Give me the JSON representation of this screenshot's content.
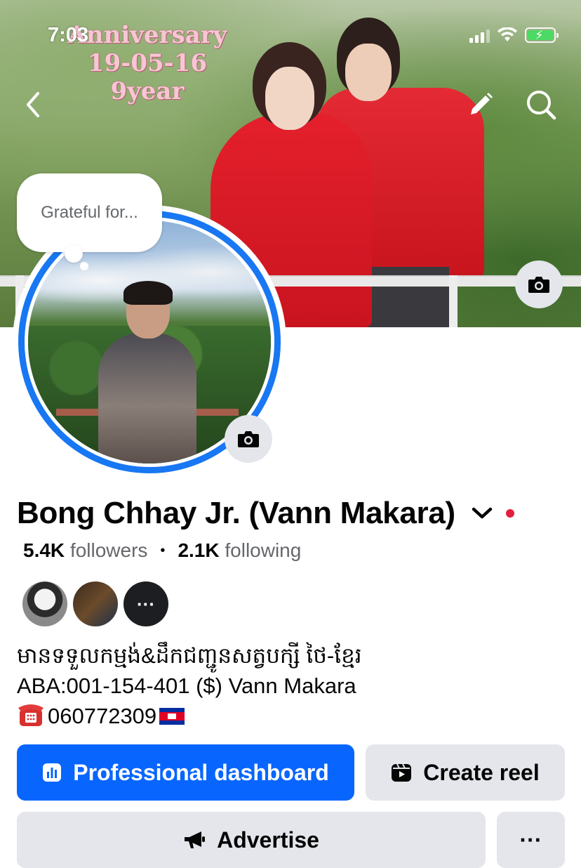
{
  "status_bar": {
    "time": "7:03",
    "battery_charging": true
  },
  "cover": {
    "overlay_lines": [
      "Anniversary",
      "19-05-16",
      "9year"
    ]
  },
  "header_icons": {
    "back": "chevron-left-icon",
    "edit": "pencil-icon",
    "search": "search-icon",
    "cover_camera": "camera-icon"
  },
  "profile": {
    "thought_bubble": "Grateful for...",
    "name": "Bong Chhay Jr. (Vann Makara)",
    "followers_count": "5.4K",
    "followers_label": "followers",
    "separator": "•",
    "following_count": "2.1K",
    "following_label": "following",
    "friends_more_label": "···",
    "bio_line1": "មានទទួលកម្មង់&ដឹកជញ្ជូនសត្វបក្សី ថៃ-ខ្មែរ",
    "bio_line2": "ABA:001-154-401 ($) Vann Makara",
    "bio_line3": "060772309"
  },
  "actions": {
    "dashboard_label": "Professional dashboard",
    "create_reel_label": "Create reel",
    "advertise_label": "Advertise",
    "more_label": "···"
  },
  "colors": {
    "accent": "#0866ff",
    "ring": "#1877f2",
    "secondary_button": "#e4e6eb",
    "notification_dot": "#e41e3f"
  }
}
